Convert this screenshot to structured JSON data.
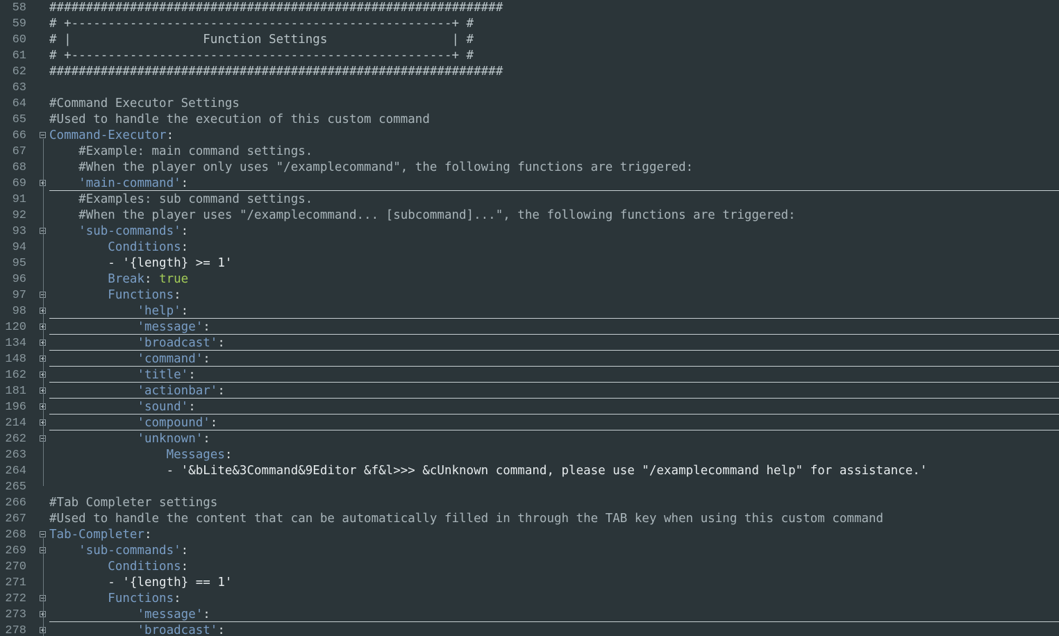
{
  "editor": {
    "lines": [
      {
        "num": "58",
        "indent": 0,
        "fold": "",
        "tokens": [
          {
            "t": "##############################################################",
            "c": "hash"
          }
        ]
      },
      {
        "num": "59",
        "indent": 0,
        "fold": "",
        "tokens": [
          {
            "t": "# +----------------------------------------------------+ #",
            "c": "hash"
          }
        ]
      },
      {
        "num": "60",
        "indent": 0,
        "fold": "",
        "tokens": [
          {
            "t": "# |                  Function Settings                 | #",
            "c": "hash"
          }
        ]
      },
      {
        "num": "61",
        "indent": 0,
        "fold": "",
        "tokens": [
          {
            "t": "# +----------------------------------------------------+ #",
            "c": "hash"
          }
        ]
      },
      {
        "num": "62",
        "indent": 0,
        "fold": "",
        "tokens": [
          {
            "t": "##############################################################",
            "c": "hash"
          }
        ]
      },
      {
        "num": "63",
        "indent": 0,
        "fold": "",
        "tokens": []
      },
      {
        "num": "64",
        "indent": 0,
        "fold": "",
        "tokens": [
          {
            "t": "#Command Executor Settings",
            "c": "comment"
          }
        ]
      },
      {
        "num": "65",
        "indent": 0,
        "fold": "",
        "tokens": [
          {
            "t": "#Used to handle the execution of this custom command",
            "c": "comment"
          }
        ]
      },
      {
        "num": "66",
        "indent": 0,
        "fold": "minus",
        "tokens": [
          {
            "t": "Command-Executor",
            "c": "key"
          },
          {
            "t": ":",
            "c": "punct"
          }
        ]
      },
      {
        "num": "67",
        "indent": 1,
        "fold": "",
        "tokens": [
          {
            "t": "#Example: main command settings.",
            "c": "comment"
          }
        ]
      },
      {
        "num": "68",
        "indent": 1,
        "fold": "",
        "tokens": [
          {
            "t": "#When the player only uses \"/examplecommand\", the following functions are triggered:",
            "c": "comment"
          }
        ]
      },
      {
        "num": "69",
        "indent": 1,
        "fold": "plus",
        "tokens": [
          {
            "t": "'main-command'",
            "c": "key"
          },
          {
            "t": ":",
            "c": "punct"
          }
        ]
      },
      {
        "num": "91",
        "indent": 1,
        "fold": "",
        "tokens": [
          {
            "t": "#Examples: sub command settings.",
            "c": "comment"
          }
        ]
      },
      {
        "num": "92",
        "indent": 1,
        "fold": "",
        "tokens": [
          {
            "t": "#When the player uses \"/examplecommand... [subcommand]...\", the following functions are triggered:",
            "c": "comment"
          }
        ]
      },
      {
        "num": "93",
        "indent": 1,
        "fold": "minus",
        "tokens": [
          {
            "t": "'sub-commands'",
            "c": "key"
          },
          {
            "t": ":",
            "c": "punct"
          }
        ]
      },
      {
        "num": "94",
        "indent": 2,
        "fold": "",
        "tokens": [
          {
            "t": "Conditions",
            "c": "key"
          },
          {
            "t": ":",
            "c": "punct"
          }
        ]
      },
      {
        "num": "95",
        "indent": 2,
        "fold": "",
        "tokens": [
          {
            "t": "- '{length} >= 1'",
            "c": "plain"
          }
        ]
      },
      {
        "num": "96",
        "indent": 2,
        "fold": "",
        "tokens": [
          {
            "t": "Break",
            "c": "key"
          },
          {
            "t": ": ",
            "c": "punct"
          },
          {
            "t": "true",
            "c": "bool"
          }
        ]
      },
      {
        "num": "97",
        "indent": 2,
        "fold": "minus",
        "tokens": [
          {
            "t": "Functions",
            "c": "key"
          },
          {
            "t": ":",
            "c": "punct"
          }
        ]
      },
      {
        "num": "98",
        "indent": 3,
        "fold": "plus",
        "tokens": [
          {
            "t": "'help'",
            "c": "key"
          },
          {
            "t": ":",
            "c": "punct"
          }
        ]
      },
      {
        "num": "120",
        "indent": 3,
        "fold": "plus",
        "tokens": [
          {
            "t": "'message'",
            "c": "key"
          },
          {
            "t": ":",
            "c": "punct"
          }
        ]
      },
      {
        "num": "134",
        "indent": 3,
        "fold": "plus",
        "tokens": [
          {
            "t": "'broadcast'",
            "c": "key"
          },
          {
            "t": ":",
            "c": "punct"
          }
        ]
      },
      {
        "num": "148",
        "indent": 3,
        "fold": "plus",
        "tokens": [
          {
            "t": "'command'",
            "c": "key"
          },
          {
            "t": ":",
            "c": "punct"
          }
        ]
      },
      {
        "num": "162",
        "indent": 3,
        "fold": "plus",
        "tokens": [
          {
            "t": "'title'",
            "c": "key"
          },
          {
            "t": ":",
            "c": "punct"
          }
        ]
      },
      {
        "num": "181",
        "indent": 3,
        "fold": "plus",
        "tokens": [
          {
            "t": "'actionbar'",
            "c": "key"
          },
          {
            "t": ":",
            "c": "punct"
          }
        ]
      },
      {
        "num": "196",
        "indent": 3,
        "fold": "plus",
        "tokens": [
          {
            "t": "'sound'",
            "c": "key"
          },
          {
            "t": ":",
            "c": "punct"
          }
        ]
      },
      {
        "num": "214",
        "indent": 3,
        "fold": "plus",
        "tokens": [
          {
            "t": "'compound'",
            "c": "key"
          },
          {
            "t": ":",
            "c": "punct"
          }
        ]
      },
      {
        "num": "262",
        "indent": 3,
        "fold": "minus",
        "tokens": [
          {
            "t": "'unknown'",
            "c": "key"
          },
          {
            "t": ":",
            "c": "punct"
          }
        ]
      },
      {
        "num": "263",
        "indent": 4,
        "fold": "",
        "tokens": [
          {
            "t": "Messages",
            "c": "key"
          },
          {
            "t": ":",
            "c": "punct"
          }
        ]
      },
      {
        "num": "264",
        "indent": 4,
        "fold": "",
        "tokens": [
          {
            "t": "- '&bLite&3Command&9Editor &f&l>>> &cUnknown command, please use \"/examplecommand help\" for assistance.'",
            "c": "plain"
          }
        ]
      },
      {
        "num": "265",
        "indent": 0,
        "fold": "",
        "tokens": []
      },
      {
        "num": "266",
        "indent": 0,
        "fold": "",
        "tokens": [
          {
            "t": "#Tab Completer settings",
            "c": "comment"
          }
        ]
      },
      {
        "num": "267",
        "indent": 0,
        "fold": "",
        "tokens": [
          {
            "t": "#Used to handle the content that can be automatically filled in through the TAB key when using this custom command",
            "c": "comment"
          }
        ]
      },
      {
        "num": "268",
        "indent": 0,
        "fold": "minus",
        "tokens": [
          {
            "t": "Tab-Completer",
            "c": "key"
          },
          {
            "t": ":",
            "c": "punct"
          }
        ]
      },
      {
        "num": "269",
        "indent": 1,
        "fold": "minus",
        "tokens": [
          {
            "t": "'sub-commands'",
            "c": "key"
          },
          {
            "t": ":",
            "c": "punct"
          }
        ]
      },
      {
        "num": "270",
        "indent": 2,
        "fold": "",
        "tokens": [
          {
            "t": "Conditions",
            "c": "key"
          },
          {
            "t": ":",
            "c": "punct"
          }
        ]
      },
      {
        "num": "271",
        "indent": 2,
        "fold": "",
        "tokens": [
          {
            "t": "- '{length} == 1'",
            "c": "plain"
          }
        ]
      },
      {
        "num": "272",
        "indent": 2,
        "fold": "minus",
        "tokens": [
          {
            "t": "Functions",
            "c": "key"
          },
          {
            "t": ":",
            "c": "punct"
          }
        ]
      },
      {
        "num": "273",
        "indent": 3,
        "fold": "plus",
        "tokens": [
          {
            "t": "'message'",
            "c": "key"
          },
          {
            "t": ":",
            "c": "punct"
          }
        ]
      },
      {
        "num": "278",
        "indent": 3,
        "fold": "plus",
        "tokens": [
          {
            "t": "'broadcast'",
            "c": "key"
          },
          {
            "t": ":",
            "c": "punct"
          }
        ]
      }
    ]
  }
}
